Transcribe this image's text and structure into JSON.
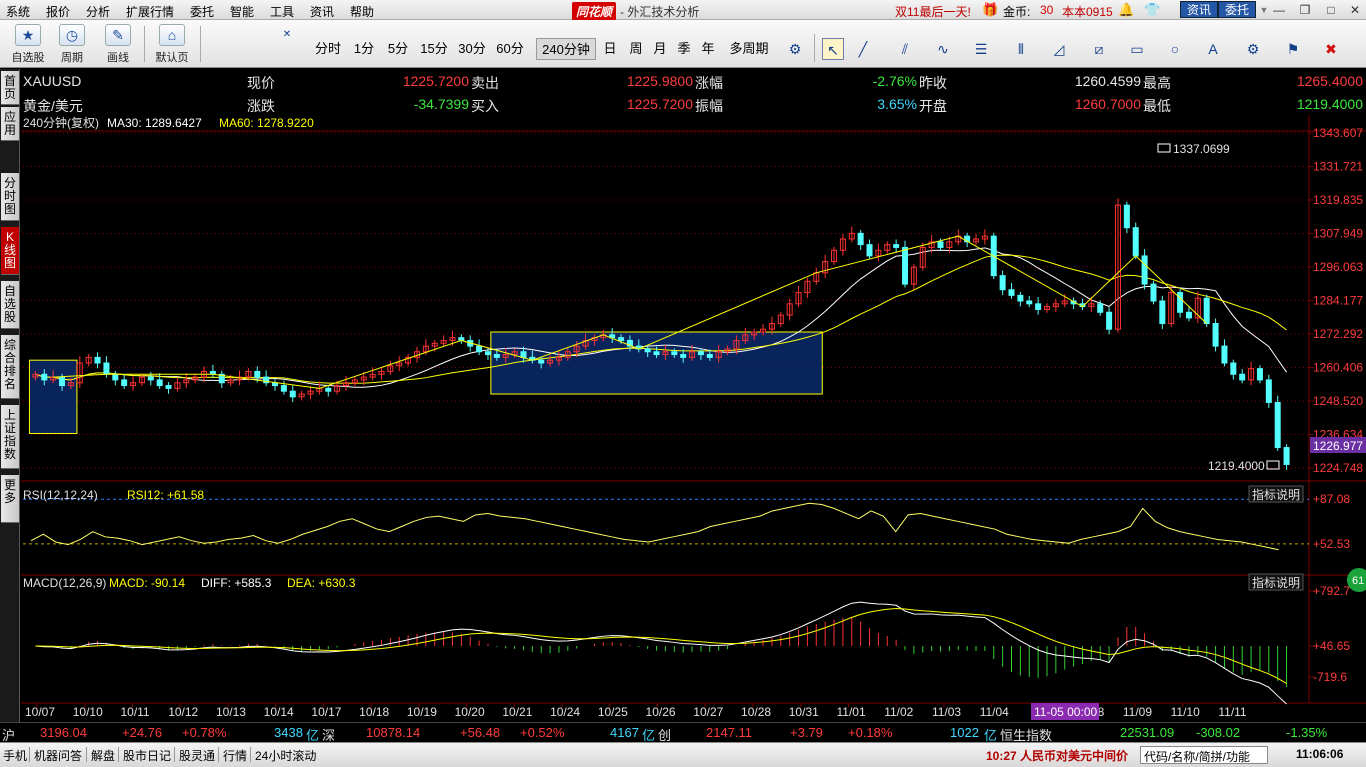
{
  "menubar": {
    "items": [
      "系统",
      "报价",
      "分析",
      "扩展行情",
      "委托",
      "智能",
      "工具",
      "资讯",
      "帮助"
    ],
    "logo": "同花顺",
    "window_title": "- 外汇技术分析",
    "promo": "双11最后一天!",
    "coins_label": "金币:",
    "coins_value": "30",
    "account": "本本0915",
    "info_button": "资讯",
    "trade_button": "委托"
  },
  "toolbar": {
    "self_select": "自选股",
    "cycle": "周期",
    "draw": "画线",
    "default_page": "默认页",
    "periods": [
      "分时",
      "1分",
      "5分",
      "15分",
      "30分",
      "60分",
      "240分钟",
      "日",
      "周",
      "月",
      "季",
      "年",
      "多周期"
    ],
    "active_period": "240分钟"
  },
  "left_tabs": [
    "首页",
    "应用",
    "分时图",
    "K线图",
    "自选股",
    "综合排名",
    "上证指数",
    "更多"
  ],
  "quote": {
    "symbol": "XAUUSD",
    "name": "黄金/美元",
    "current_label": "现价",
    "current": "1225.7200",
    "change_label": "涨跌",
    "change": "-34.7399",
    "sell_label": "卖出",
    "sell": "1225.9800",
    "buy_label": "买入",
    "buy": "1225.7200",
    "pct_label": "涨幅",
    "pct": "-2.76%",
    "amp_label": "振幅",
    "amp": "3.65%",
    "prev_label": "昨收",
    "prev": "1260.4599",
    "open_label": "开盘",
    "open": "1260.7000",
    "high_label": "最高",
    "high": "1265.4000",
    "low_label": "最低",
    "low": "1219.4000"
  },
  "chart_data": {
    "type": "candlestick",
    "ma_label": "240分钟(复权)",
    "ma30_text": "MA30: 1289.6427",
    "ma60_text": "MA60: 1278.9220",
    "price_axis": [
      "1343.607",
      "1331.721",
      "1319.835",
      "1307.949",
      "1296.063",
      "1284.177",
      "1272.292",
      "1260.406",
      "1248.520",
      "1236.634",
      "1224.748"
    ],
    "price_range": [
      1224.748,
      1343.607
    ],
    "current_price_tag": "1226.977",
    "max_marker": "1337.0699",
    "min_marker": "1219.4000",
    "rsi_label": "RSI(12,12,24)",
    "rsi_value_text": "RSI12: +61.58",
    "rsi_axis": [
      "+87.08",
      "+52.53"
    ],
    "macd_label": "MACD(12,26,9)",
    "macd_value_text": "MACD: -90.14",
    "diff_text": "DIFF: +585.3",
    "dea_text": "DEA: +630.3",
    "macd_axis": [
      "+792.7",
      "+46.65",
      "-719.6"
    ],
    "indicator_button": "指标说明",
    "dates": [
      "10/07",
      "10/10",
      "10/11",
      "10/12",
      "10/13",
      "10/14",
      "10/17",
      "10/18",
      "10/19",
      "10/20",
      "10/21",
      "10/24",
      "10/25",
      "10/26",
      "10/27",
      "10/28",
      "10/31",
      "11/01",
      "11/02",
      "11/03",
      "11/04",
      "11-05 00:00",
      "11/08",
      "11/09",
      "11/10",
      "11/11"
    ],
    "cursor_date": "11-05 00:00",
    "close": [
      1258,
      1256,
      1257,
      1254,
      1255,
      1262,
      1264,
      1262,
      1258,
      1256,
      1254,
      1255,
      1257,
      1256,
      1254,
      1253,
      1255,
      1256,
      1257,
      1259,
      1258,
      1255,
      1256,
      1257,
      1259,
      1257,
      1255,
      1254,
      1252,
      1250,
      1251,
      1252,
      1253,
      1252,
      1254,
      1255,
      1256,
      1257,
      1258,
      1259,
      1261,
      1262,
      1264,
      1266,
      1268,
      1269,
      1270,
      1271,
      1270,
      1268,
      1266,
      1265,
      1264,
      1265,
      1266,
      1264,
      1263,
      1262,
      1263,
      1264,
      1266,
      1268,
      1270,
      1271,
      1272,
      1271,
      1270,
      1268,
      1267,
      1266,
      1265,
      1266,
      1265,
      1264,
      1266,
      1265,
      1264,
      1266,
      1267,
      1270,
      1272,
      1273,
      1274,
      1276,
      1279,
      1283,
      1287,
      1291,
      1294,
      1298,
      1302,
      1306,
      1308,
      1304,
      1300,
      1302,
      1304,
      1303,
      1290,
      1296,
      1303,
      1305,
      1303,
      1305,
      1307,
      1305,
      1306,
      1307,
      1293,
      1288,
      1286,
      1284,
      1283,
      1281,
      1282,
      1283,
      1284,
      1283,
      1282,
      1283,
      1280,
      1274,
      1318,
      1310,
      1300,
      1290,
      1284,
      1276,
      1287,
      1280,
      1278,
      1285,
      1276,
      1268,
      1262,
      1258,
      1256,
      1260,
      1256,
      1248,
      1232,
      1226
    ],
    "rsi_values": [
      55,
      60,
      54,
      52,
      56,
      62,
      58,
      57,
      55,
      52,
      54,
      56,
      58,
      55,
      53,
      54,
      56,
      57,
      59,
      55,
      53,
      56,
      60,
      63,
      66,
      70,
      72,
      68,
      64,
      62,
      66,
      70,
      73,
      74,
      72,
      70,
      75,
      76,
      74,
      73,
      72,
      70,
      68,
      66,
      64,
      62,
      60,
      58,
      56,
      55,
      54,
      56,
      58,
      60,
      62,
      66,
      68,
      70,
      72,
      74,
      78,
      80,
      82,
      84,
      83,
      80,
      76,
      72,
      78,
      74,
      62,
      75,
      76,
      74,
      72,
      70,
      68,
      66,
      64,
      60,
      58,
      56,
      55,
      54,
      53,
      56,
      58,
      60,
      62,
      66,
      80,
      70,
      65,
      62,
      60,
      58,
      56,
      55,
      54,
      52,
      50,
      48
    ],
    "rsi_current": 61.58
  },
  "ticker": {
    "sh_label": "沪",
    "sh_index": "3196.04",
    "sh_chg": "+24.76",
    "sh_pct": "+0.78%",
    "sh_vol": "3438",
    "sh_unit": "亿",
    "sz_label": "深",
    "sz_index": "10878.14",
    "sz_chg": "+56.48",
    "sz_pct": "+0.52%",
    "sz_vol": "4167",
    "sz_unit": "亿",
    "cy_label": "创",
    "cy_index": "2147.11",
    "cy_chg": "+3.79",
    "cy_pct": "+0.18%",
    "cy_vol": "1022",
    "cy_unit": "亿",
    "hs_label": "恒生指数",
    "hs_index": "22531.09",
    "hs_chg": "-308.02",
    "hs_pct": "-1.35%"
  },
  "statusbar": {
    "tabs": [
      "手机",
      "机器问答",
      "解盘",
      "股市日记",
      "股灵通",
      "行情",
      "24小时滚动"
    ],
    "news": "10:27 人民币对美元中间价",
    "search_placeholder": "代码/名称/简拼/功能",
    "time": "11:06:06"
  },
  "colors": {
    "up": "#ff3232",
    "down": "#54ffff",
    "ma30": "#ffffff",
    "ma60": "#ffff00",
    "background": "#000000",
    "grid": "#7a0000"
  }
}
